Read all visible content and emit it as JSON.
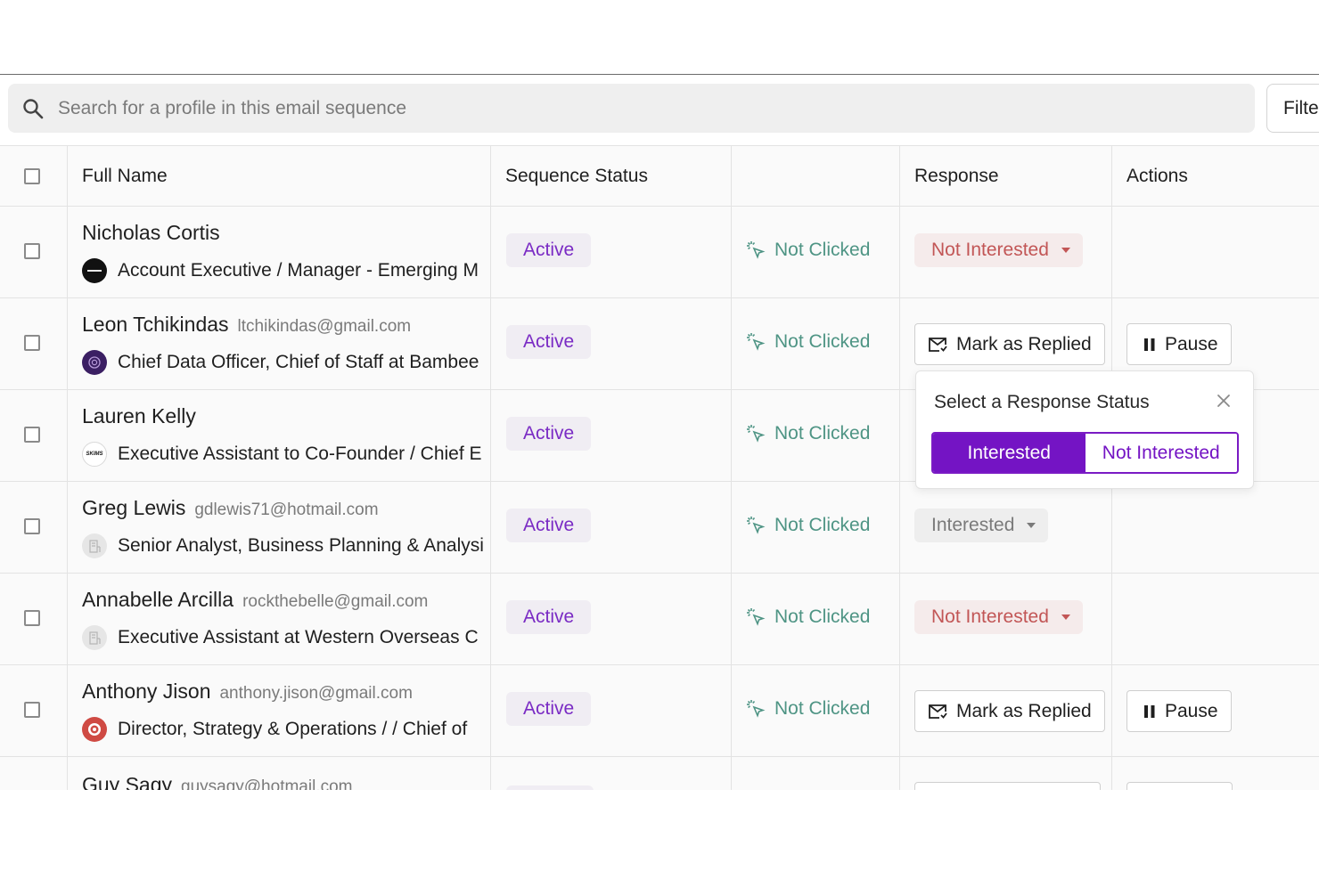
{
  "search": {
    "placeholder": "Search for a profile in this email sequence"
  },
  "toolbar": {
    "filter_label": "Filte"
  },
  "table": {
    "headers": {
      "full_name": "Full Name",
      "sequence_status": "Sequence Status",
      "click": "",
      "response": "Response",
      "actions": "Actions"
    },
    "rows": [
      {
        "name": "Nicholas Cortis",
        "email": "",
        "title": "Account Executive / Manager - Emerging M",
        "logo_icon": "docusign-logo",
        "status": "Active",
        "click": "Not Clicked",
        "response": "Not Interested",
        "response_kind": "negative"
      },
      {
        "name": "Leon Tchikindas",
        "email": "ltchikindas@gmail.com",
        "title": "Chief Data Officer, Chief of Staff at Bambee",
        "logo_icon": "bambee-logo",
        "status": "Active",
        "click": "Not Clicked",
        "mark_replied": "Mark as Replied",
        "pause": "Pause"
      },
      {
        "name": "Lauren Kelly",
        "email": "",
        "title": "Executive Assistant to Co-Founder / Chief E",
        "logo_icon": "skims-logo",
        "logo_text": "SKIMS",
        "status": "Active",
        "click": "Not Clicked"
      },
      {
        "name": "Greg Lewis",
        "email": "gdlewis71@hotmail.com",
        "title": "Senior Analyst, Business Planning & Analysi",
        "logo_icon": "building-icon",
        "status": "Active",
        "click": "Not Clicked",
        "response": "Interested",
        "response_kind": "positive"
      },
      {
        "name": "Annabelle Arcilla",
        "email": "rockthebelle@gmail.com",
        "title": "Executive Assistant at Western Overseas C",
        "logo_icon": "building-icon",
        "status": "Active",
        "click": "Not Clicked",
        "response": "Not Interested",
        "response_kind": "negative"
      },
      {
        "name": "Anthony Jison",
        "email": "anthony.jison@gmail.com",
        "title": "Director, Strategy & Operations / / Chief of",
        "logo_icon": "target-logo",
        "status": "Active",
        "click": "Not Clicked",
        "mark_replied": "Mark as Replied",
        "pause": "Pause"
      },
      {
        "name": "Guy Sagy",
        "email": "guysagy@hotmail.com"
      }
    ]
  },
  "popover": {
    "title": "Select a Response Status",
    "options": [
      "Interested",
      "Not Interested"
    ],
    "selected": "Interested"
  },
  "colors": {
    "accent_purple": "#7414c4",
    "status_active_text": "#7a2bc4",
    "not_clicked_text": "#4e9484",
    "not_interested_text": "#c25656"
  }
}
